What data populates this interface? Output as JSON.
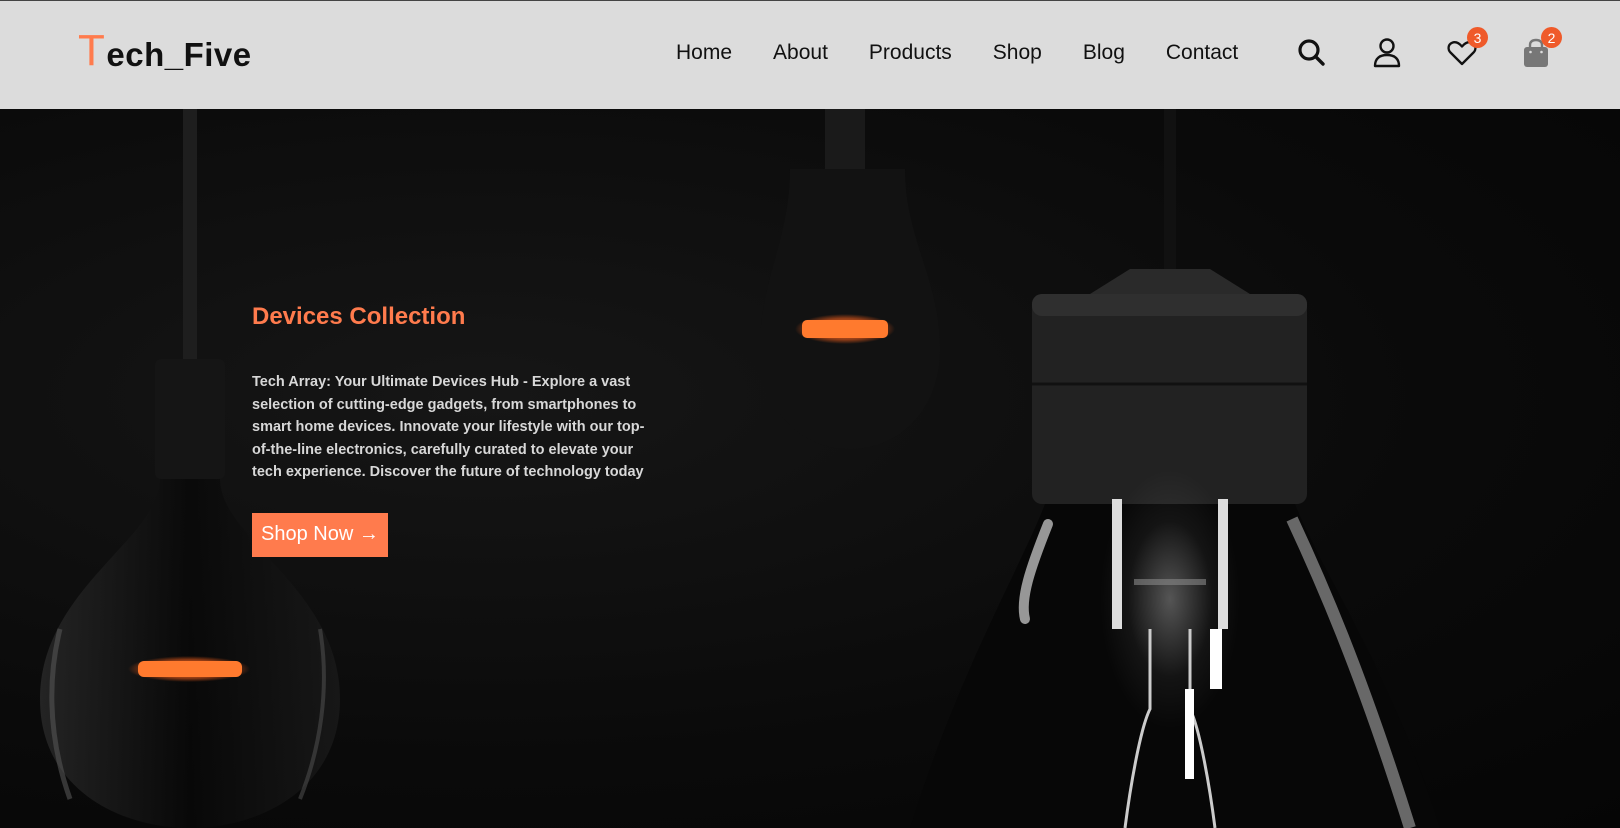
{
  "brand": {
    "logo_first": "T",
    "logo_rest": "ech_Five",
    "accent": "#ff7b4d"
  },
  "nav": {
    "items": [
      {
        "label": "Home"
      },
      {
        "label": "About"
      },
      {
        "label": "Products"
      },
      {
        "label": "Shop"
      },
      {
        "label": "Blog"
      },
      {
        "label": "Contact"
      }
    ]
  },
  "header_icons": {
    "search": "search-icon",
    "account": "user-icon",
    "wishlist": {
      "icon": "heart-icon",
      "count": "3"
    },
    "cart": {
      "icon": "shopping-bag-icon",
      "count": "2"
    },
    "badge_color": "#ef5a2a"
  },
  "hero": {
    "title": "Devices Collection",
    "description": "Tech Array: Your Ultimate Devices Hub - Explore a vast selection of cutting-edge gadgets, from smartphones to smart home devices. Innovate your lifestyle with our top-of-the-line electronics, carefully curated to elevate your tech experience. Discover the future of technology today",
    "button_label": "Shop Now →",
    "background": "hanging-light-bulbs-image"
  }
}
